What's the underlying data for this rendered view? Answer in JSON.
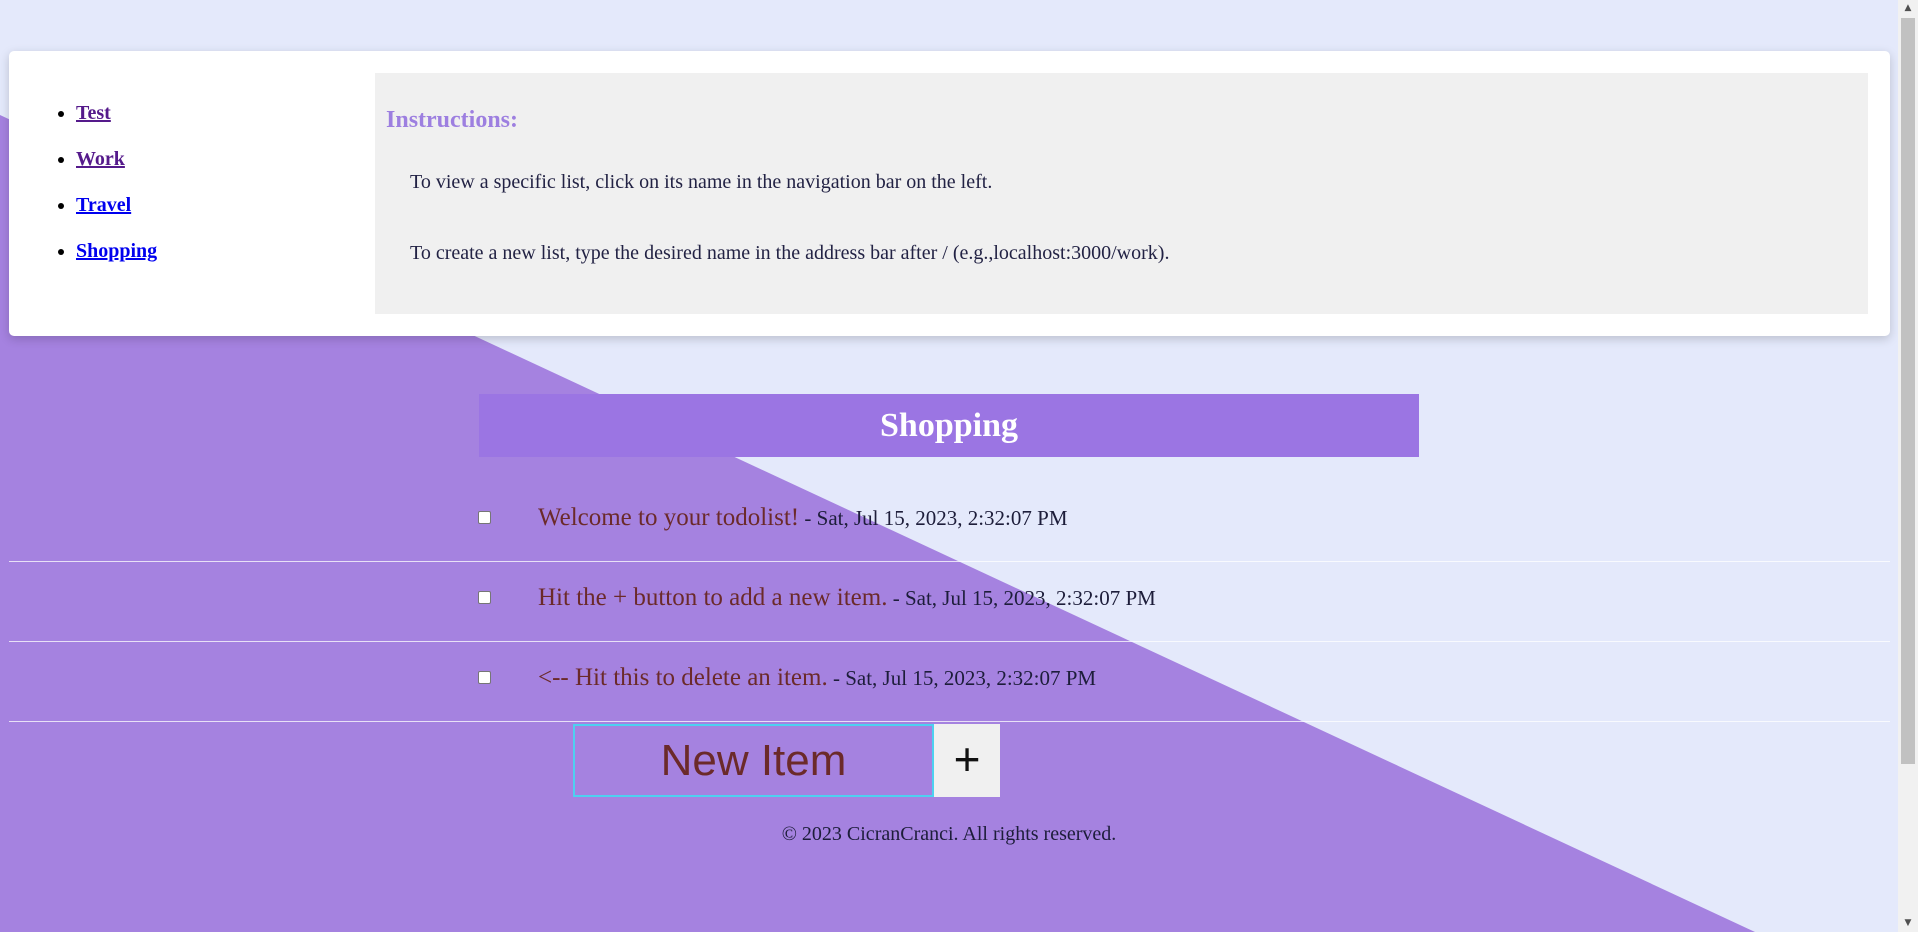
{
  "nav": {
    "items": [
      {
        "label": "Test"
      },
      {
        "label": "Work"
      },
      {
        "label": "Travel"
      },
      {
        "label": "Shopping"
      }
    ]
  },
  "instructions": {
    "title": "Instructions:",
    "line1": "To view a specific list, click on its name in the navigation bar on the left.",
    "line2": "To create a new list, type the desired name in the address bar after / (e.g.,localhost:3000/work)."
  },
  "list": {
    "title": "Shopping",
    "items": [
      {
        "text": "Welcome to your todolist!",
        "date": " - Sat, Jul 15, 2023, 2:32:07 PM"
      },
      {
        "text": "Hit the + button to add a new item.",
        "date": " - Sat, Jul 15, 2023, 2:32:07 PM"
      },
      {
        "text": "<-- Hit this to delete an item.",
        "date": " - Sat, Jul 15, 2023, 2:32:07 PM"
      }
    ]
  },
  "form": {
    "placeholder": "New Item",
    "add_label": "+"
  },
  "footer": {
    "text": "© 2023 CicranCranci. All rights reserved."
  },
  "colors": {
    "background_light": "#e4e9fb",
    "background_purple": "#a582e0",
    "title_bar": "#9b75e3",
    "instructions_heading": "#9d7fe0",
    "item_text": "#6b2a2a"
  }
}
